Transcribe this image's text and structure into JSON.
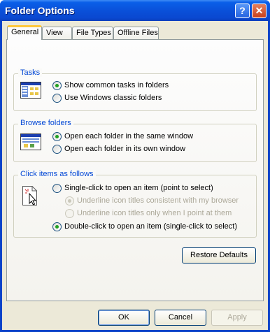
{
  "window": {
    "title": "Folder Options",
    "help_label": "?",
    "close_label": "✕"
  },
  "tabs": [
    {
      "label": "General",
      "active": true
    },
    {
      "label": "View",
      "active": false
    },
    {
      "label": "File Types",
      "active": false
    },
    {
      "label": "Offline Files",
      "active": false
    }
  ],
  "tasks": {
    "legend": "Tasks",
    "options": [
      {
        "label": "Show common tasks in folders",
        "selected": true
      },
      {
        "label": "Use Windows classic folders",
        "selected": false
      }
    ]
  },
  "browse": {
    "legend": "Browse folders",
    "options": [
      {
        "label": "Open each folder in the same window",
        "selected": true
      },
      {
        "label": "Open each folder in its own window",
        "selected": false
      }
    ]
  },
  "click": {
    "legend": "Click items as follows",
    "single": "Single-click to open an item (point to select)",
    "sub_options": [
      "Underline icon titles consistent with my browser",
      "Underline icon titles only when I point at them"
    ],
    "double": "Double-click to open an item (single-click to select)"
  },
  "buttons": {
    "restore": "Restore Defaults",
    "ok": "OK",
    "cancel": "Cancel",
    "apply": "Apply"
  },
  "colors": {
    "title_bar": "#0a4fd8",
    "group_title": "#0046d5",
    "radio_dot": "#21a121",
    "face": "#ece9d8",
    "tab_highlight": "#ffc83c"
  }
}
